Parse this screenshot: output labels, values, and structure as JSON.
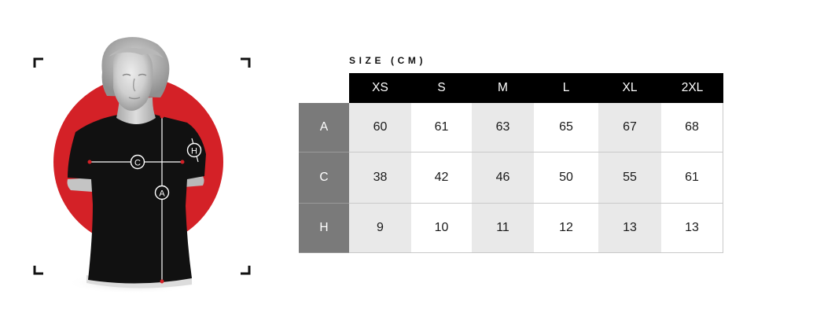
{
  "size_chart": {
    "title": "SIZE (CM)",
    "sizes": [
      "XS",
      "S",
      "M",
      "L",
      "XL",
      "2XL"
    ],
    "rows": [
      {
        "label": "A",
        "values": [
          "60",
          "61",
          "63",
          "65",
          "67",
          "68"
        ]
      },
      {
        "label": "C",
        "values": [
          "38",
          "42",
          "46",
          "50",
          "55",
          "61"
        ]
      },
      {
        "label": "H",
        "values": [
          "9",
          "10",
          "11",
          "12",
          "13",
          "13"
        ]
      }
    ]
  },
  "figure": {
    "markers": {
      "chest": "C",
      "length": "A",
      "sleeve": "H"
    },
    "accent_color": "#d42127",
    "shirt_color": "#111111"
  }
}
